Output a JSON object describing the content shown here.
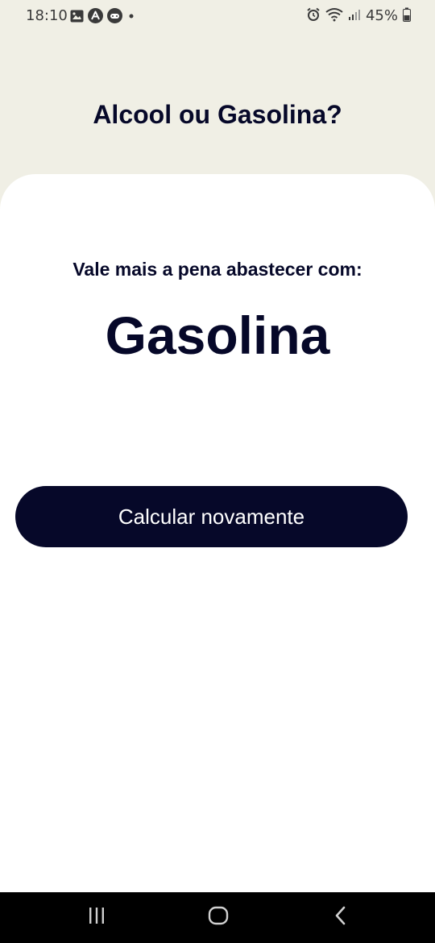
{
  "status_bar": {
    "time": "18:10",
    "battery_percent": "45%",
    "icons_left": [
      "gallery-icon",
      "a-badge-icon",
      "game-icon",
      "dot-icon"
    ],
    "icons_right": [
      "alarm-icon",
      "wifi-icon",
      "signal-icon",
      "battery-icon"
    ]
  },
  "header": {
    "title": "Alcool ou Gasolina?"
  },
  "result_card": {
    "subtitle": "Vale mais a pena abastecer com:",
    "result": "Gasolina",
    "button_label": "Calcular novamente"
  },
  "nav_bar": {
    "icons": [
      "recent-apps-icon",
      "home-icon",
      "back-icon"
    ]
  },
  "colors": {
    "background": "#F0EFE5",
    "card": "#FFFFFF",
    "primary": "#060829",
    "button_text": "#FFFFFF",
    "nav_bar": "#000000"
  }
}
